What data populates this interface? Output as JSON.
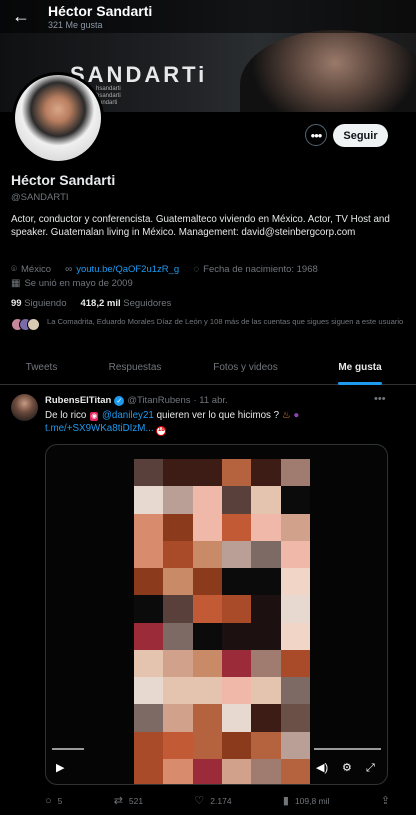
{
  "header": {
    "name": "Héctor Sandarti",
    "likes_count": "321 Me gusta"
  },
  "banner": {
    "brand": "SANDARTi",
    "tagline": [
      "hsandarti",
      "hsandarti",
      "sandarti"
    ]
  },
  "profile": {
    "follow_label": "Seguir",
    "more_label": "•••",
    "display_name": "Héctor Sandarti",
    "handle": "@SANDARTI",
    "bio": "Actor, conductor y conferencista. Guatemalteco viviendo en México. Actor, TV Host and speaker. Guatemalan living in México. Management: david@steinbergcorp.com",
    "location": "México",
    "website": "youtu.be/QaOF2u1zR_g",
    "birth": "Fecha de nacimiento: 1968",
    "joined": "Se unió en mayo de 2009",
    "following_count": "99",
    "following_label": "Siguiendo",
    "followers_count": "418,2 mil",
    "followers_label": "Seguidores",
    "followed_by": "La Comadrita, Eduardo Morales Díaz de León y 108 más de las cuentas que sigues siguen a este usuario"
  },
  "tabs": [
    "Tweets",
    "Respuestas",
    "Fotos y videos",
    "Me gusta"
  ],
  "active_tab": "Me gusta",
  "tweet": {
    "name": "RubensElTitan",
    "handle": "@TitanRubens",
    "date": "· 11 abr.",
    "text_start": "De lo rico",
    "mention": "@daniley21",
    "text_end": "quieren ver lo que hicimos ?",
    "url": "t.me/+SX9WKa8tiDIzM...",
    "adult_badge": "18",
    "stats": {
      "replies": "5",
      "retweets": "521",
      "likes": "2.174",
      "views": "109,8 mil"
    }
  },
  "icons": {
    "back": "arrow-left-icon",
    "location": "map-pin-icon",
    "link": "link-icon",
    "birthday": "balloon-icon",
    "calendar": "calendar-icon",
    "reply": "reply-icon",
    "retweet": "retweet-icon",
    "like": "heart-icon",
    "views": "views-icon",
    "share": "share-icon",
    "play": "play-icon",
    "volume": "volume-icon",
    "settings": "settings-icon",
    "fullscreen": "fullscreen-icon"
  },
  "colors": {
    "accent": "#1d9bf0",
    "background": "#000000",
    "text": "#e7e9ea",
    "muted": "#71767b"
  }
}
